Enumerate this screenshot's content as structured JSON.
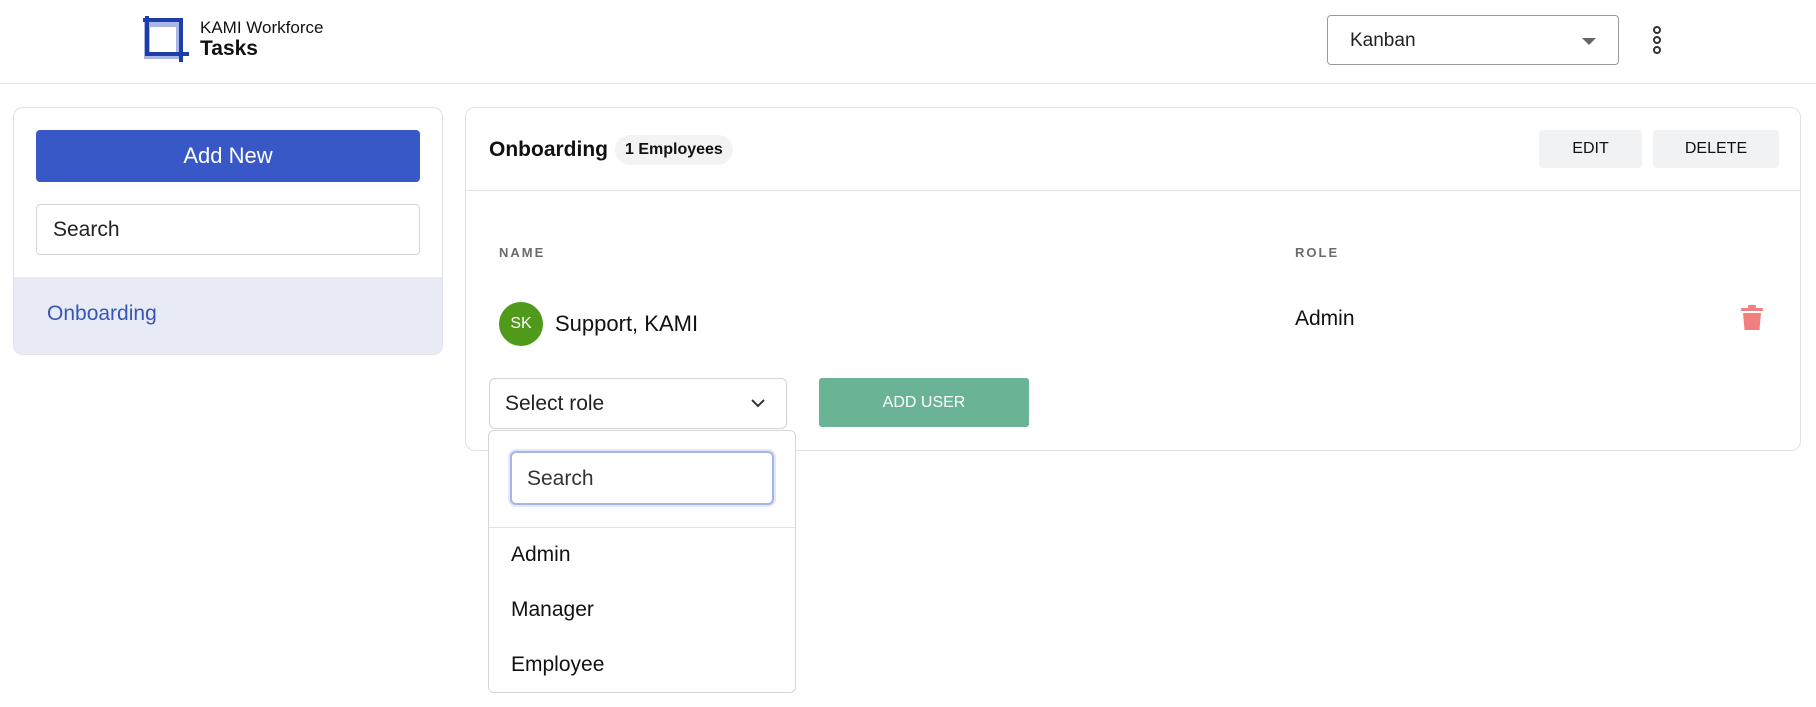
{
  "header": {
    "brand_sub": "KAMI Workforce",
    "brand_title": "Tasks",
    "view_select": "Kanban"
  },
  "sidebar": {
    "add_new": "Add New",
    "search_placeholder": "Search",
    "items": [
      {
        "label": "Onboarding"
      }
    ]
  },
  "main": {
    "title": "Onboarding",
    "badge": "1 Employees",
    "edit_label": "EDIT",
    "delete_label": "DELETE",
    "columns": {
      "name": "NAME",
      "role": "ROLE"
    },
    "rows": [
      {
        "initials": "SK",
        "name": "Support, KAMI",
        "role": "Admin"
      }
    ],
    "role_select": "Select role",
    "add_user": "ADD USER"
  },
  "dropdown": {
    "search_placeholder": "Search",
    "options": [
      "Admin",
      "Manager",
      "Employee"
    ]
  },
  "colors": {
    "primary": "#3858c8",
    "add_user": "#6ab395",
    "avatar": "#4f9a1a",
    "trash": "#f08080"
  }
}
